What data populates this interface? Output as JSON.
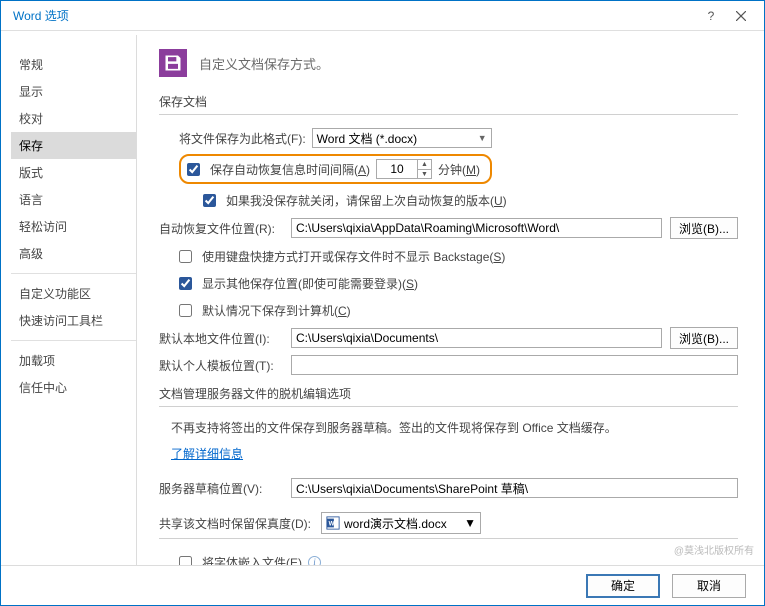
{
  "window": {
    "title": "Word 选项",
    "help": "?",
    "close": "×"
  },
  "sidebar": {
    "items": [
      {
        "label": "常规"
      },
      {
        "label": "显示"
      },
      {
        "label": "校对"
      },
      {
        "label": "保存",
        "selected": true
      },
      {
        "label": "版式"
      },
      {
        "label": "语言"
      },
      {
        "label": "轻松访问"
      },
      {
        "label": "高级"
      }
    ],
    "group2": [
      {
        "label": "自定义功能区"
      },
      {
        "label": "快速访问工具栏"
      }
    ],
    "group3": [
      {
        "label": "加载项"
      },
      {
        "label": "信任中心"
      }
    ]
  },
  "header": {
    "text": "自定义文档保存方式。"
  },
  "sec1": {
    "title": "保存文档",
    "format_label": "将文件保存为此格式(F):",
    "format_value": "Word 文档 (*.docx)",
    "autosave_label_pre": "保存自动恢复信息时间间隔(",
    "autosave_label_post": ")",
    "autosave_value": "10",
    "minutes_label_pre": "分钟(",
    "minutes_label_post": ")",
    "keep_last_pre": "如果我没保存就关闭，请保留上次自动恢复的版本(",
    "keep_last_post": ")",
    "recover_loc_label": "自动恢复文件位置(R):",
    "recover_loc_value": "C:\\Users\\qixia\\AppData\\Roaming\\Microsoft\\Word\\",
    "browse": "浏览(B)...",
    "backstage_pre": "使用键盘快捷方式打开或保存文件时不显示 Backstage(",
    "backstage_post": ")",
    "other_loc_pre": "显示其他保存位置(即使可能需要登录)(",
    "other_loc_post": ")",
    "default_comp_pre": "默认情况下保存到计算机(",
    "default_comp_post": ")",
    "local_loc_label": "默认本地文件位置(I):",
    "local_loc_value": "C:\\Users\\qixia\\Documents\\",
    "template_loc_label": "默认个人模板位置(T):",
    "template_loc_value": ""
  },
  "sec2": {
    "title": "文档管理服务器文件的脱机编辑选项",
    "desc": "不再支持将签出的文件保存到服务器草稿。签出的文件现将保存到 Office 文档缓存。",
    "link": "了解详细信息",
    "draft_label": "服务器草稿位置(V):",
    "draft_value": "C:\\Users\\qixia\\Documents\\SharePoint 草稿\\"
  },
  "sec3": {
    "title": "共享该文档时保留保真度(D):",
    "doc_value": "word演示文档.docx",
    "embed_fonts_pre": "将字体嵌入文件(",
    "embed_fonts_post": ")"
  },
  "footer": {
    "ok": "确定",
    "cancel": "取消"
  },
  "watermark": "@莫浅北版权所有"
}
